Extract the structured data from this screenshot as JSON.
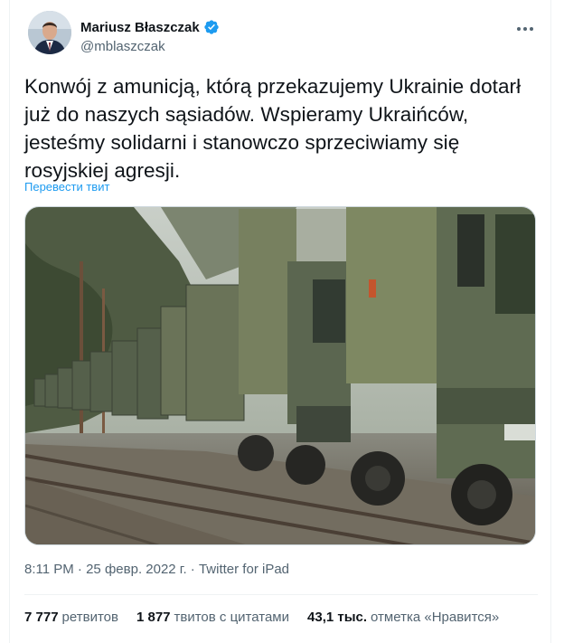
{
  "author": {
    "name": "Mariusz Błaszczak",
    "handle": "@mblaszczak",
    "verified": true
  },
  "tweet": {
    "text": "Konwój z amunicją, którą przekazujemy Ukrainie dotarł\njuż do naszych sąsiadów. Wspieramy Ukraińców,\njesteśmy solidarni i stanowczo sprzeciwiamy się\nrosyjskiej agresji.",
    "translate_label": "Перевести твит"
  },
  "meta": {
    "time": "8:11 PM",
    "separator": "·",
    "date": "25 февр. 2022 г.",
    "source": "Twitter for iPad"
  },
  "stats": {
    "retweets_count": "7 777",
    "retweets_label": "ретвитов",
    "quotes_count": "1 877",
    "quotes_label": "твитов с цитатами",
    "likes_count": "43,1 тыс.",
    "likes_label": "отметка «Нравится»"
  },
  "icons": {
    "verified": "verified-badge-icon",
    "more": "more-options-icon"
  },
  "colors": {
    "link": "#1d9bf0",
    "secondary_text": "#536471",
    "primary_text": "#0f1419",
    "divider": "#eff3f4"
  }
}
